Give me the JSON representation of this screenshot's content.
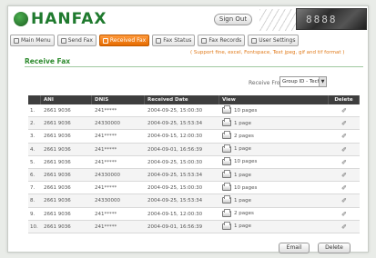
{
  "header": {
    "brand": "HANFAX",
    "sign_out": "Sign Out",
    "lcd_text": "8888"
  },
  "nav": [
    {
      "label": "Main Menu",
      "active": false
    },
    {
      "label": "Send Fax",
      "active": false
    },
    {
      "label": "Received Fax",
      "active": true
    },
    {
      "label": "Fax Status",
      "active": false
    },
    {
      "label": "Fax Records",
      "active": false
    },
    {
      "label": "User Settings",
      "active": false
    }
  ],
  "notice": "( Support fine, excel, Fontspace, Text jpeg, gif and tif format )",
  "page_title": "Receive Fax",
  "filter": {
    "label": "Receive From",
    "selected": "Group ID - Tech"
  },
  "table": {
    "headers": [
      "",
      "ANI",
      "DNIS",
      "Received Date",
      "View",
      "Delete"
    ],
    "rows": [
      {
        "num": "1.",
        "ani": "2661 9036",
        "dnis": "241*****",
        "date": "2004-09-25, 15:00:30",
        "pages": "10 pages"
      },
      {
        "num": "2.",
        "ani": "2661 9036",
        "dnis": "24330000",
        "date": "2004-09-25, 15:53:34",
        "pages": "1 page"
      },
      {
        "num": "3.",
        "ani": "2661 9036",
        "dnis": "241*****",
        "date": "2004-09-15, 12:00:30",
        "pages": "2 pages"
      },
      {
        "num": "4.",
        "ani": "2661 9036",
        "dnis": "241*****",
        "date": "2004-09-01, 16:56:39",
        "pages": "1 page"
      },
      {
        "num": "5.",
        "ani": "2661 9036",
        "dnis": "241*****",
        "date": "2004-09-25, 15:00:30",
        "pages": "10 pages"
      },
      {
        "num": "6.",
        "ani": "2661 9036",
        "dnis": "24330000",
        "date": "2004-09-25, 15:53:34",
        "pages": "1 page"
      },
      {
        "num": "7.",
        "ani": "2661 9036",
        "dnis": "241*****",
        "date": "2004-09-25, 15:00:30",
        "pages": "10 pages"
      },
      {
        "num": "8.",
        "ani": "2661 9036",
        "dnis": "24330000",
        "date": "2004-09-25, 15:53:34",
        "pages": "1 page"
      },
      {
        "num": "9.",
        "ani": "2661 9036",
        "dnis": "241*****",
        "date": "2004-09-15, 12:00:30",
        "pages": "2 pages"
      },
      {
        "num": "10.",
        "ani": "2661 9036",
        "dnis": "241*****",
        "date": "2004-09-01, 16:56:39",
        "pages": "1 page"
      }
    ]
  },
  "buttons": {
    "email": "Email",
    "delete": "Delete"
  }
}
